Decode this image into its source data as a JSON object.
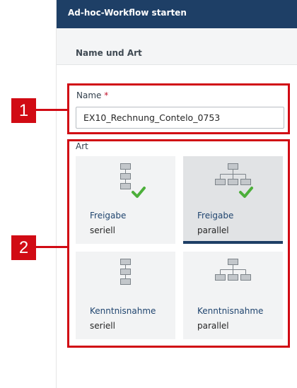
{
  "header": {
    "title": "Ad-hoc-Workflow starten"
  },
  "section": {
    "title": "Name und Art"
  },
  "name_field": {
    "label": "Name",
    "required_marker": "*",
    "value": "EX10_Rechnung_Contelo_0753"
  },
  "art": {
    "label": "Art",
    "options": [
      {
        "title": "Freigabe",
        "subtitle": "seriell",
        "icon": "serial-approval-icon",
        "selected": false
      },
      {
        "title": "Freigabe",
        "subtitle": "parallel",
        "icon": "parallel-approval-icon",
        "selected": true
      },
      {
        "title": "Kenntnisnahme",
        "subtitle": "seriell",
        "icon": "serial-acknowledge-icon",
        "selected": false
      },
      {
        "title": "Kenntnisnahme",
        "subtitle": "parallel",
        "icon": "parallel-acknowledge-icon",
        "selected": false
      }
    ]
  },
  "callouts": [
    "1",
    "2"
  ],
  "colors": {
    "header": "#1e3f66",
    "accent": "#d10b14",
    "check": "#4caf3a"
  }
}
